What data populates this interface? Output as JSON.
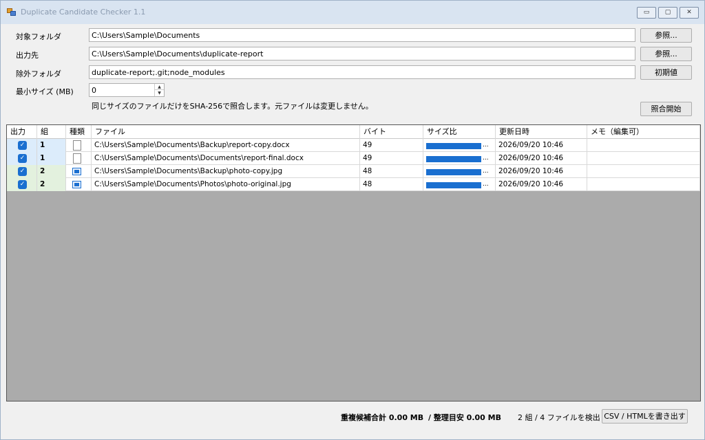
{
  "window": {
    "title": "Duplicate Candidate Checker 1.1",
    "min": "▭",
    "max": "▢",
    "close": "✕"
  },
  "form": {
    "target_label": "対象フォルダ",
    "target_value": "C:\\Users\\Sample\\Documents",
    "output_label": "出力先",
    "output_value": "C:\\Users\\Sample\\Documents\\duplicate-report",
    "exclude_label": "除外フォルダ",
    "exclude_value": "duplicate-report;.git;node_modules",
    "minsize_label": "最小サイズ (MB)",
    "minsize_value": "0",
    "browse1": "参照...",
    "browse2": "参照...",
    "reset": "初期値",
    "description": "同じサイズのファイルだけをSHA-256で照合します。元ファイルは変更しません。",
    "start": "照合開始"
  },
  "table": {
    "headers": [
      "出力",
      "組",
      "種類",
      "ファイル",
      "バイト",
      "サイズ比",
      "更新日時",
      "メモ（編集可）"
    ],
    "rows": [
      {
        "checked": true,
        "group": "1",
        "type": "doc-icon",
        "file": "C:\\Users\\Sample\\Documents\\Backup\\report-copy.docx",
        "bytes": "49",
        "ratio": 1.0,
        "modified": "2026/09/20 10:46",
        "memo": "",
        "group_color": "#dcecfb"
      },
      {
        "checked": true,
        "group": "1",
        "type": "doc-icon",
        "file": "C:\\Users\\Sample\\Documents\\Documents\\report-final.docx",
        "bytes": "49",
        "ratio": 1.0,
        "modified": "2026/09/20 10:46",
        "memo": "",
        "group_color": "#dcecfb"
      },
      {
        "checked": true,
        "group": "2",
        "type": "image-icon",
        "file": "C:\\Users\\Sample\\Documents\\Backup\\photo-copy.jpg",
        "bytes": "48",
        "ratio": 1.0,
        "modified": "2026/09/20 10:46",
        "memo": "",
        "group_color": "#e3f1de"
      },
      {
        "checked": true,
        "group": "2",
        "type": "image-icon",
        "file": "C:\\Users\\Sample\\Documents\\Photos\\photo-original.jpg",
        "bytes": "48",
        "ratio": 1.0,
        "modified": "2026/09/20 10:46",
        "memo": "",
        "group_color": "#e3f1de"
      }
    ]
  },
  "footer": {
    "total": "重複候補合計 0.00 MB",
    "cleanup": "/ 整理目安 0.00 MB",
    "count": "2 組 / 4 ファイルを検出",
    "export": "CSV / HTMLを書き出す"
  }
}
